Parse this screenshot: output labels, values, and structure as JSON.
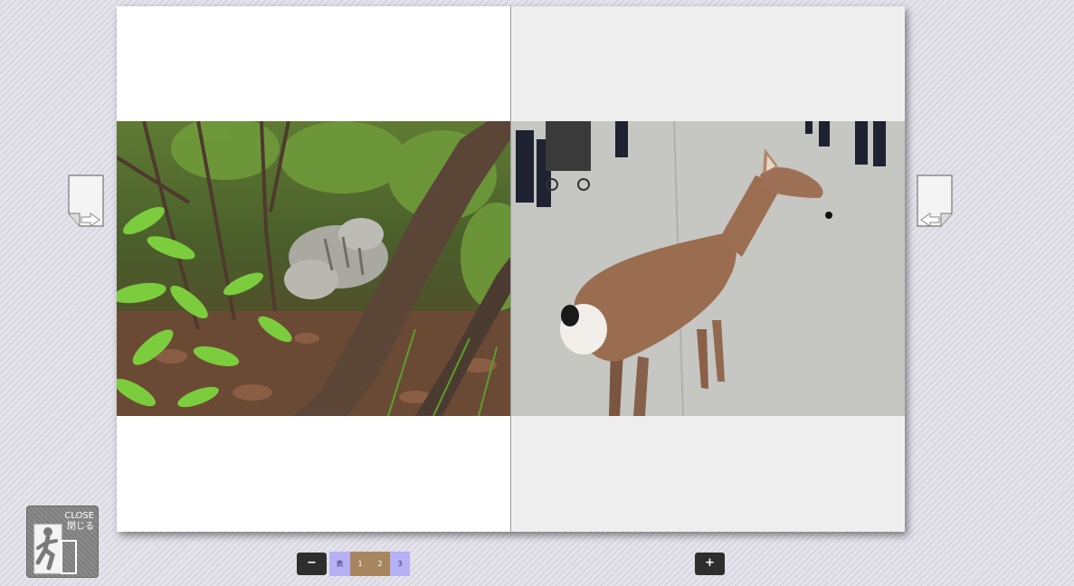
{
  "viewer": {
    "close_label_en": "CLOSE",
    "close_label_ja": "閉じる"
  },
  "page_nav": {
    "cover_label": "表",
    "current_spread": [
      "1",
      "2"
    ],
    "next_label": "3"
  },
  "zoom": {
    "out_label": "−",
    "in_label": "+"
  },
  "pages": {
    "left_photo": "cat-in-bushes-photo",
    "right_photo": "deer-on-path-photo"
  },
  "colors": {
    "page_nav_inactive": "#b6b0f4",
    "page_nav_active": "#a6855f",
    "button_dark": "#2e2e2e",
    "close_button": "#858585"
  }
}
